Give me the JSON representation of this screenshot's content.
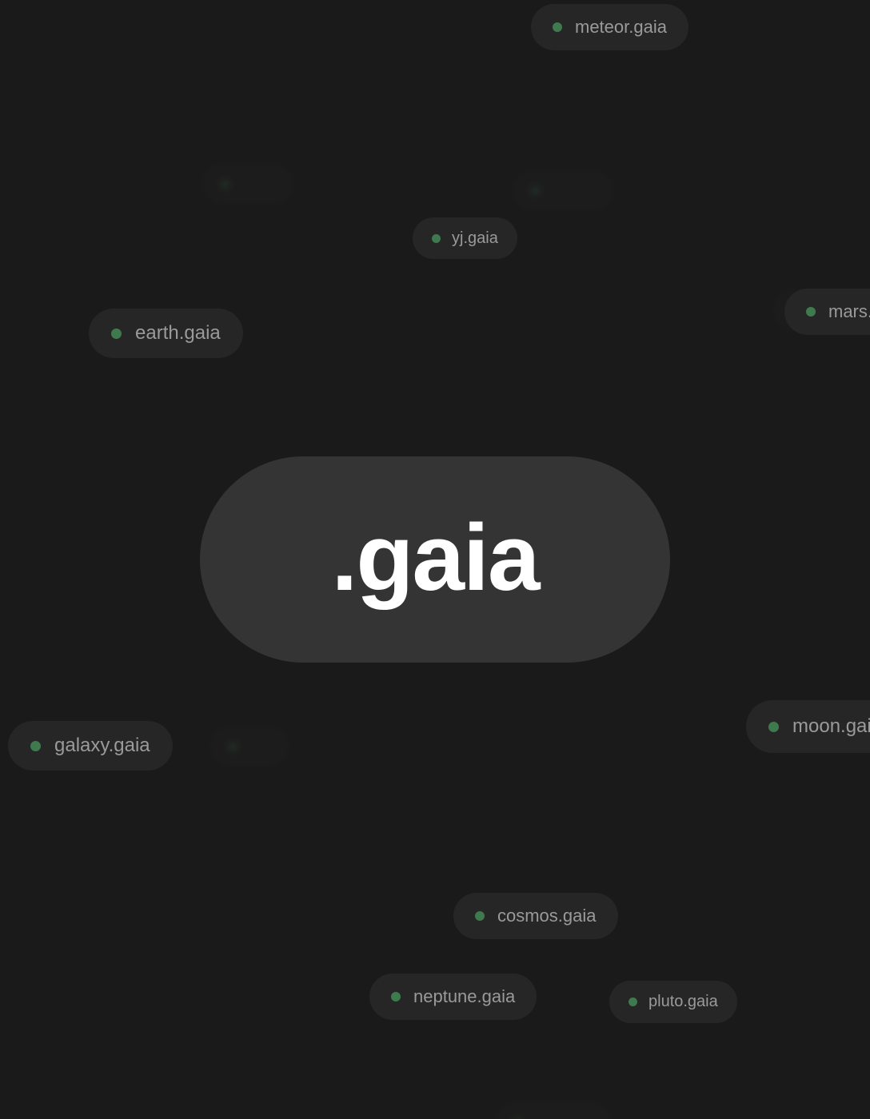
{
  "hero": {
    "label": ".gaia"
  },
  "domains": [
    {
      "id": "meteor",
      "label": "meteor.gaia"
    },
    {
      "id": "yj",
      "label": "yj.gaia"
    },
    {
      "id": "earth",
      "label": "earth.gaia"
    },
    {
      "id": "mars",
      "label": "mars.gaia"
    },
    {
      "id": "galaxy",
      "label": "galaxy.gaia"
    },
    {
      "id": "moon",
      "label": "moon.gaia"
    },
    {
      "id": "cosmos",
      "label": "cosmos.gaia"
    },
    {
      "id": "neptune",
      "label": "neptune.gaia"
    },
    {
      "id": "pluto",
      "label": "pluto.gaia"
    }
  ],
  "colors": {
    "background": "#1a1a1a",
    "pill_background": "#262626",
    "hero_background": "#343434",
    "status_dot": "#3f7a4f",
    "pill_text": "#9a9a9a",
    "hero_text": "#ffffff"
  }
}
